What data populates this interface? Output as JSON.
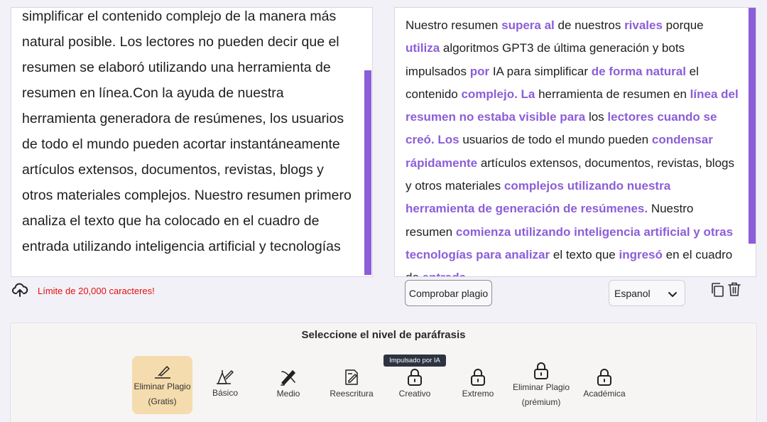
{
  "input": {
    "text": "simplificar el contenido complejo de la manera más natural posible. Los lectores no pueden decir que el resumen se elaboró utilizando una herramienta de resumen en línea.Con la ayuda de nuestra herramienta generadora de resúmenes, los usuarios de todo el mundo pueden acortar instantáneamente artículos extensos, documentos, revistas, blogs y otros materiales complejos. Nuestro resumen primero analiza el texto que ha colocado en el cuadro de entrada utilizando inteligencia artificial y tecnologías",
    "limit_text": "Límite de 20,000 caracteres!",
    "upload_icon": "cloud-upload-icon"
  },
  "output": {
    "segments": [
      {
        "t": "Nuestro resumen ",
        "h": false
      },
      {
        "t": "supera al",
        "h": true
      },
      {
        "t": " de nuestros ",
        "h": false
      },
      {
        "t": "rivales",
        "h": true
      },
      {
        "t": " porque ",
        "h": false
      },
      {
        "t": "utiliza",
        "h": true
      },
      {
        "t": " algoritmos GPT3 de última generación y bots impulsados ",
        "h": false
      },
      {
        "t": "por",
        "h": true
      },
      {
        "t": " IA para simplificar ",
        "h": false
      },
      {
        "t": "de forma natural",
        "h": true
      },
      {
        "t": " el contenido ",
        "h": false
      },
      {
        "t": "complejo. La",
        "h": true
      },
      {
        "t": " herramienta de resumen en ",
        "h": false
      },
      {
        "t": "línea del resumen no estaba visible para",
        "h": true
      },
      {
        "t": " los ",
        "h": false
      },
      {
        "t": "lectores cuando se creó. Los",
        "h": true
      },
      {
        "t": " usuarios de todo el mundo pueden ",
        "h": false
      },
      {
        "t": "condensar rápidamente",
        "h": true
      },
      {
        "t": " artículos extensos, documentos, revistas, blogs y otros materiales ",
        "h": false
      },
      {
        "t": "complejos utilizando nuestra herramienta de generación de resúmenes.",
        "h": true
      },
      {
        "t": " Nuestro resumen ",
        "h": false
      },
      {
        "t": "comienza utilizando inteligencia artificial y otras tecnologías para analizar",
        "h": true
      },
      {
        "t": " el texto que ",
        "h": false
      },
      {
        "t": "ingresó",
        "h": true
      },
      {
        "t": " en el cuadro de ",
        "h": false
      },
      {
        "t": "entrada.",
        "h": true
      }
    ],
    "highlight_color": "#8c5ed8"
  },
  "controls": {
    "check_plagiarism_label": "Comprobar plagio",
    "language_value": "Espanol",
    "copy_icon": "copy-icon",
    "delete_icon": "trash-icon"
  },
  "modes": {
    "title": "Seleccione el nivel de paráfrasis",
    "tooltip": "Impulsado por IA",
    "items": [
      {
        "label": "Eliminar Plagio",
        "sub": "(Gratis)",
        "icon": "pen-nib-icon",
        "active": true,
        "locked": false
      },
      {
        "label": "Básico",
        "sub": "",
        "icon": "pen-tool-icon",
        "active": false,
        "locked": false
      },
      {
        "label": "Medio",
        "sub": "",
        "icon": "brush-pen-icon",
        "active": false,
        "locked": false
      },
      {
        "label": "Reescritura",
        "sub": "",
        "icon": "edit-document-icon",
        "active": false,
        "locked": false
      },
      {
        "label": "Creativo",
        "sub": "",
        "icon": "lock-icon",
        "active": false,
        "locked": true
      },
      {
        "label": "Extremo",
        "sub": "",
        "icon": "lock-icon",
        "active": false,
        "locked": true
      },
      {
        "label": "Eliminar Plagio",
        "sub": "(prémium)",
        "icon": "lock-icon",
        "active": false,
        "locked": true
      },
      {
        "label": "Académica",
        "sub": "",
        "icon": "lock-icon",
        "active": false,
        "locked": true
      }
    ],
    "active_color": "#f5dcae"
  }
}
